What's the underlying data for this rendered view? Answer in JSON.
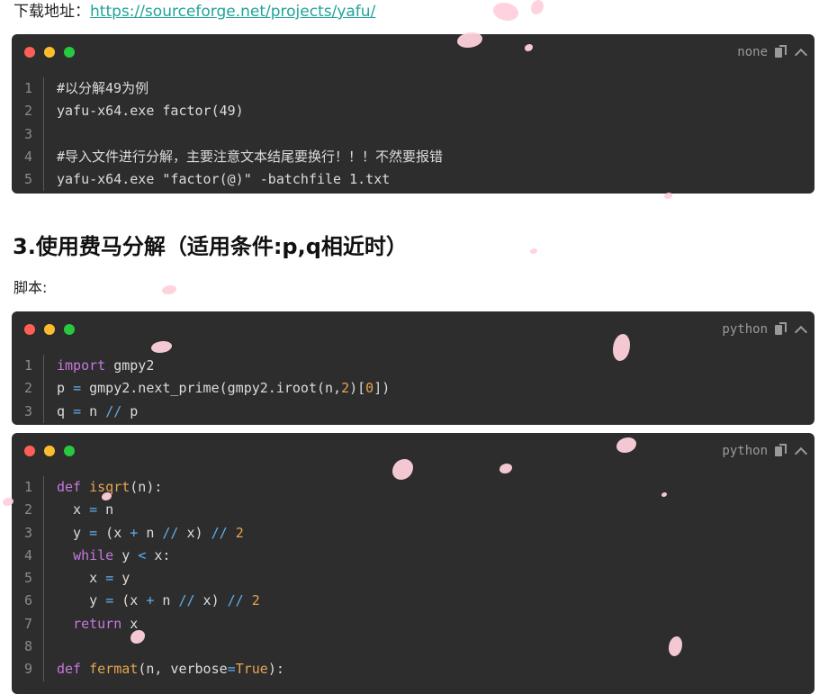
{
  "download": {
    "label": "下载地址：",
    "url": "https://sourceforge.net/projects/yafu/"
  },
  "block1": {
    "lang": "none",
    "lines": [
      {
        "n": "1",
        "parts": [
          {
            "t": "#以分解49为例",
            "c": "plain"
          }
        ]
      },
      {
        "n": "2",
        "parts": [
          {
            "t": "yafu-x64.exe factor(49)",
            "c": "plain"
          }
        ]
      },
      {
        "n": "3",
        "parts": []
      },
      {
        "n": "4",
        "parts": [
          {
            "t": "#导入文件进行分解，主要注意文本结尾要换行！！！不然要报错",
            "c": "plain"
          }
        ]
      },
      {
        "n": "5",
        "parts": [
          {
            "t": "yafu-x64.exe \"factor(@)\" -batchfile 1.txt",
            "c": "plain"
          }
        ]
      }
    ]
  },
  "heading": "3.使用费马分解（适用条件:p,q相近时）",
  "script_label": "脚本:",
  "block2": {
    "lang": "python",
    "lines": [
      {
        "n": "1",
        "parts": [
          {
            "t": "import",
            "c": "kw"
          },
          {
            "t": " gmpy2",
            "c": "plain"
          }
        ]
      },
      {
        "n": "2",
        "parts": [
          {
            "t": "p ",
            "c": "plain"
          },
          {
            "t": "=",
            "c": "op"
          },
          {
            "t": " gmpy2.next_prime(gmpy2.iroot(n,",
            "c": "plain"
          },
          {
            "t": "2",
            "c": "num"
          },
          {
            "t": ")[",
            "c": "plain"
          },
          {
            "t": "0",
            "c": "num"
          },
          {
            "t": "])",
            "c": "plain"
          }
        ]
      },
      {
        "n": "3",
        "parts": [
          {
            "t": "q ",
            "c": "plain"
          },
          {
            "t": "=",
            "c": "op"
          },
          {
            "t": " n ",
            "c": "plain"
          },
          {
            "t": "//",
            "c": "op"
          },
          {
            "t": " p",
            "c": "plain"
          }
        ]
      }
    ]
  },
  "block3": {
    "lang": "python",
    "lines": [
      {
        "n": "1",
        "parts": [
          {
            "t": "def",
            "c": "kw"
          },
          {
            "t": " ",
            "c": "plain"
          },
          {
            "t": "isqrt",
            "c": "fn"
          },
          {
            "t": "(n):",
            "c": "plain"
          }
        ]
      },
      {
        "n": "2",
        "parts": [
          {
            "t": "  x ",
            "c": "plain"
          },
          {
            "t": "=",
            "c": "op"
          },
          {
            "t": " n",
            "c": "plain"
          }
        ]
      },
      {
        "n": "3",
        "parts": [
          {
            "t": "  y ",
            "c": "plain"
          },
          {
            "t": "=",
            "c": "op"
          },
          {
            "t": " (x ",
            "c": "plain"
          },
          {
            "t": "+",
            "c": "op"
          },
          {
            "t": " n ",
            "c": "plain"
          },
          {
            "t": "//",
            "c": "op"
          },
          {
            "t": " x) ",
            "c": "plain"
          },
          {
            "t": "//",
            "c": "op"
          },
          {
            "t": " ",
            "c": "plain"
          },
          {
            "t": "2",
            "c": "num"
          }
        ]
      },
      {
        "n": "4",
        "parts": [
          {
            "t": "  ",
            "c": "plain"
          },
          {
            "t": "while",
            "c": "kw"
          },
          {
            "t": " y ",
            "c": "plain"
          },
          {
            "t": "<",
            "c": "op"
          },
          {
            "t": " x:",
            "c": "plain"
          }
        ]
      },
      {
        "n": "5",
        "parts": [
          {
            "t": "    x ",
            "c": "plain"
          },
          {
            "t": "=",
            "c": "op"
          },
          {
            "t": " y",
            "c": "plain"
          }
        ]
      },
      {
        "n": "6",
        "parts": [
          {
            "t": "    y ",
            "c": "plain"
          },
          {
            "t": "=",
            "c": "op"
          },
          {
            "t": " (x ",
            "c": "plain"
          },
          {
            "t": "+",
            "c": "op"
          },
          {
            "t": " n ",
            "c": "plain"
          },
          {
            "t": "//",
            "c": "op"
          },
          {
            "t": " x) ",
            "c": "plain"
          },
          {
            "t": "//",
            "c": "op"
          },
          {
            "t": " ",
            "c": "plain"
          },
          {
            "t": "2",
            "c": "num"
          }
        ]
      },
      {
        "n": "7",
        "parts": [
          {
            "t": "  ",
            "c": "plain"
          },
          {
            "t": "return",
            "c": "kw"
          },
          {
            "t": " x",
            "c": "plain"
          }
        ]
      },
      {
        "n": "8",
        "parts": []
      },
      {
        "n": "9",
        "parts": [
          {
            "t": "def",
            "c": "kw"
          },
          {
            "t": " ",
            "c": "plain"
          },
          {
            "t": "fermat",
            "c": "fn"
          },
          {
            "t": "(n, verbose",
            "c": "plain"
          },
          {
            "t": "=",
            "c": "op"
          },
          {
            "t": "True",
            "c": "num"
          },
          {
            "t": "):",
            "c": "plain"
          }
        ]
      }
    ]
  }
}
